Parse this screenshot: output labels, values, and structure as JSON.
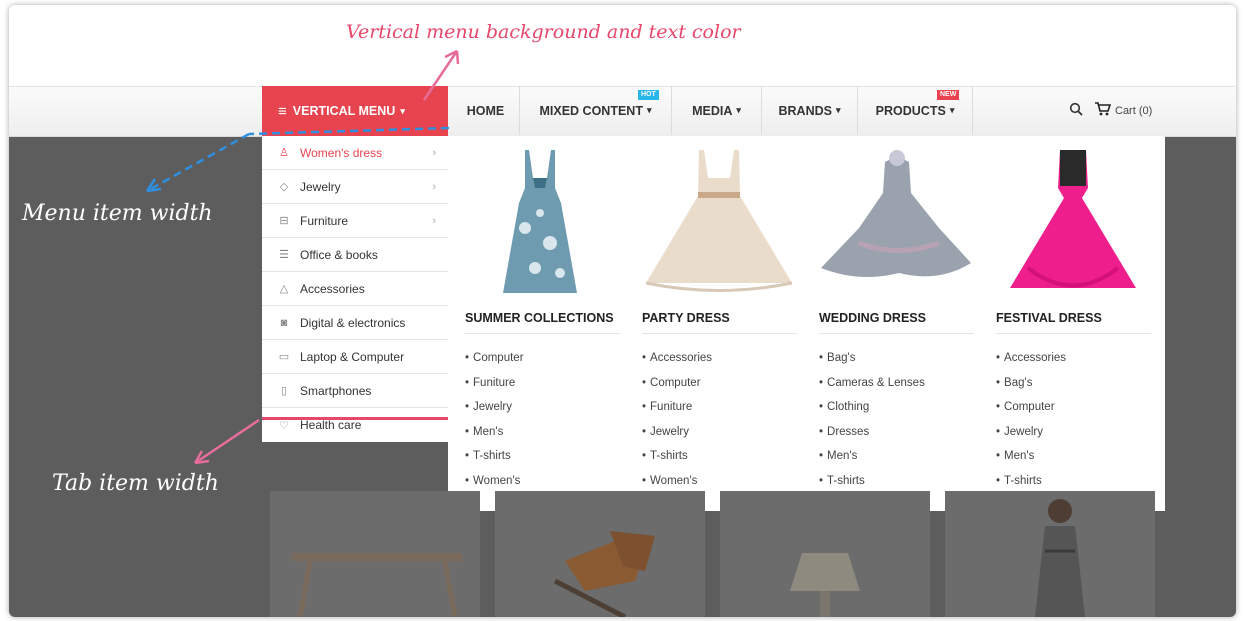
{
  "annotations": {
    "title": "Vertical menu background and text color",
    "menu_item_width": "Menu item width",
    "tab_item_width": "Tab item width"
  },
  "navbar": {
    "vertical_menu_label": "VERTICAL MENU",
    "items": [
      {
        "label": "HOME"
      },
      {
        "label": "MIXED CONTENT",
        "badge": "HOT",
        "badge_color": "#29b6e8"
      },
      {
        "label": "MEDIA"
      },
      {
        "label": "BRANDS"
      },
      {
        "label": "PRODUCTS",
        "badge": "NEW",
        "badge_color": "#e8444f"
      }
    ],
    "cart_label": "Cart (0)",
    "accent_color": "#e8444f"
  },
  "vertical_menu": {
    "items": [
      {
        "label": "Women's dress",
        "icon": "dress-icon",
        "has_submenu": true,
        "active": true
      },
      {
        "label": "Jewelry",
        "icon": "diamond-icon",
        "has_submenu": true
      },
      {
        "label": "Furniture",
        "icon": "sofa-icon",
        "has_submenu": true
      },
      {
        "label": "Office & books",
        "icon": "books-icon"
      },
      {
        "label": "Accessories",
        "icon": "hanger-icon"
      },
      {
        "label": "Digital & electronics",
        "icon": "camera-icon"
      },
      {
        "label": "Laptop & Computer",
        "icon": "laptop-icon"
      },
      {
        "label": "Smartphones",
        "icon": "phone-icon"
      },
      {
        "label": "Health care",
        "icon": "heart-icon"
      }
    ]
  },
  "mega_menu": {
    "columns": [
      {
        "title": "SUMMER COLLECTIONS",
        "items": [
          "Computer",
          "Funiture",
          "Jewelry",
          "Men's",
          "T-shirts",
          "Women's"
        ]
      },
      {
        "title": "PARTY DRESS",
        "items": [
          "Accessories",
          "Computer",
          "Funiture",
          "Jewelry",
          "T-shirts",
          "Women's"
        ]
      },
      {
        "title": "WEDDING DRESS",
        "items": [
          "Bag's",
          "Cameras & Lenses",
          "Clothing",
          "Dresses",
          "Men's",
          "T-shirts"
        ]
      },
      {
        "title": "FESTIVAL DRESS",
        "items": [
          "Accessories",
          "Bag's",
          "Computer",
          "Jewelry",
          "Men's",
          "T-shirts"
        ]
      }
    ]
  }
}
